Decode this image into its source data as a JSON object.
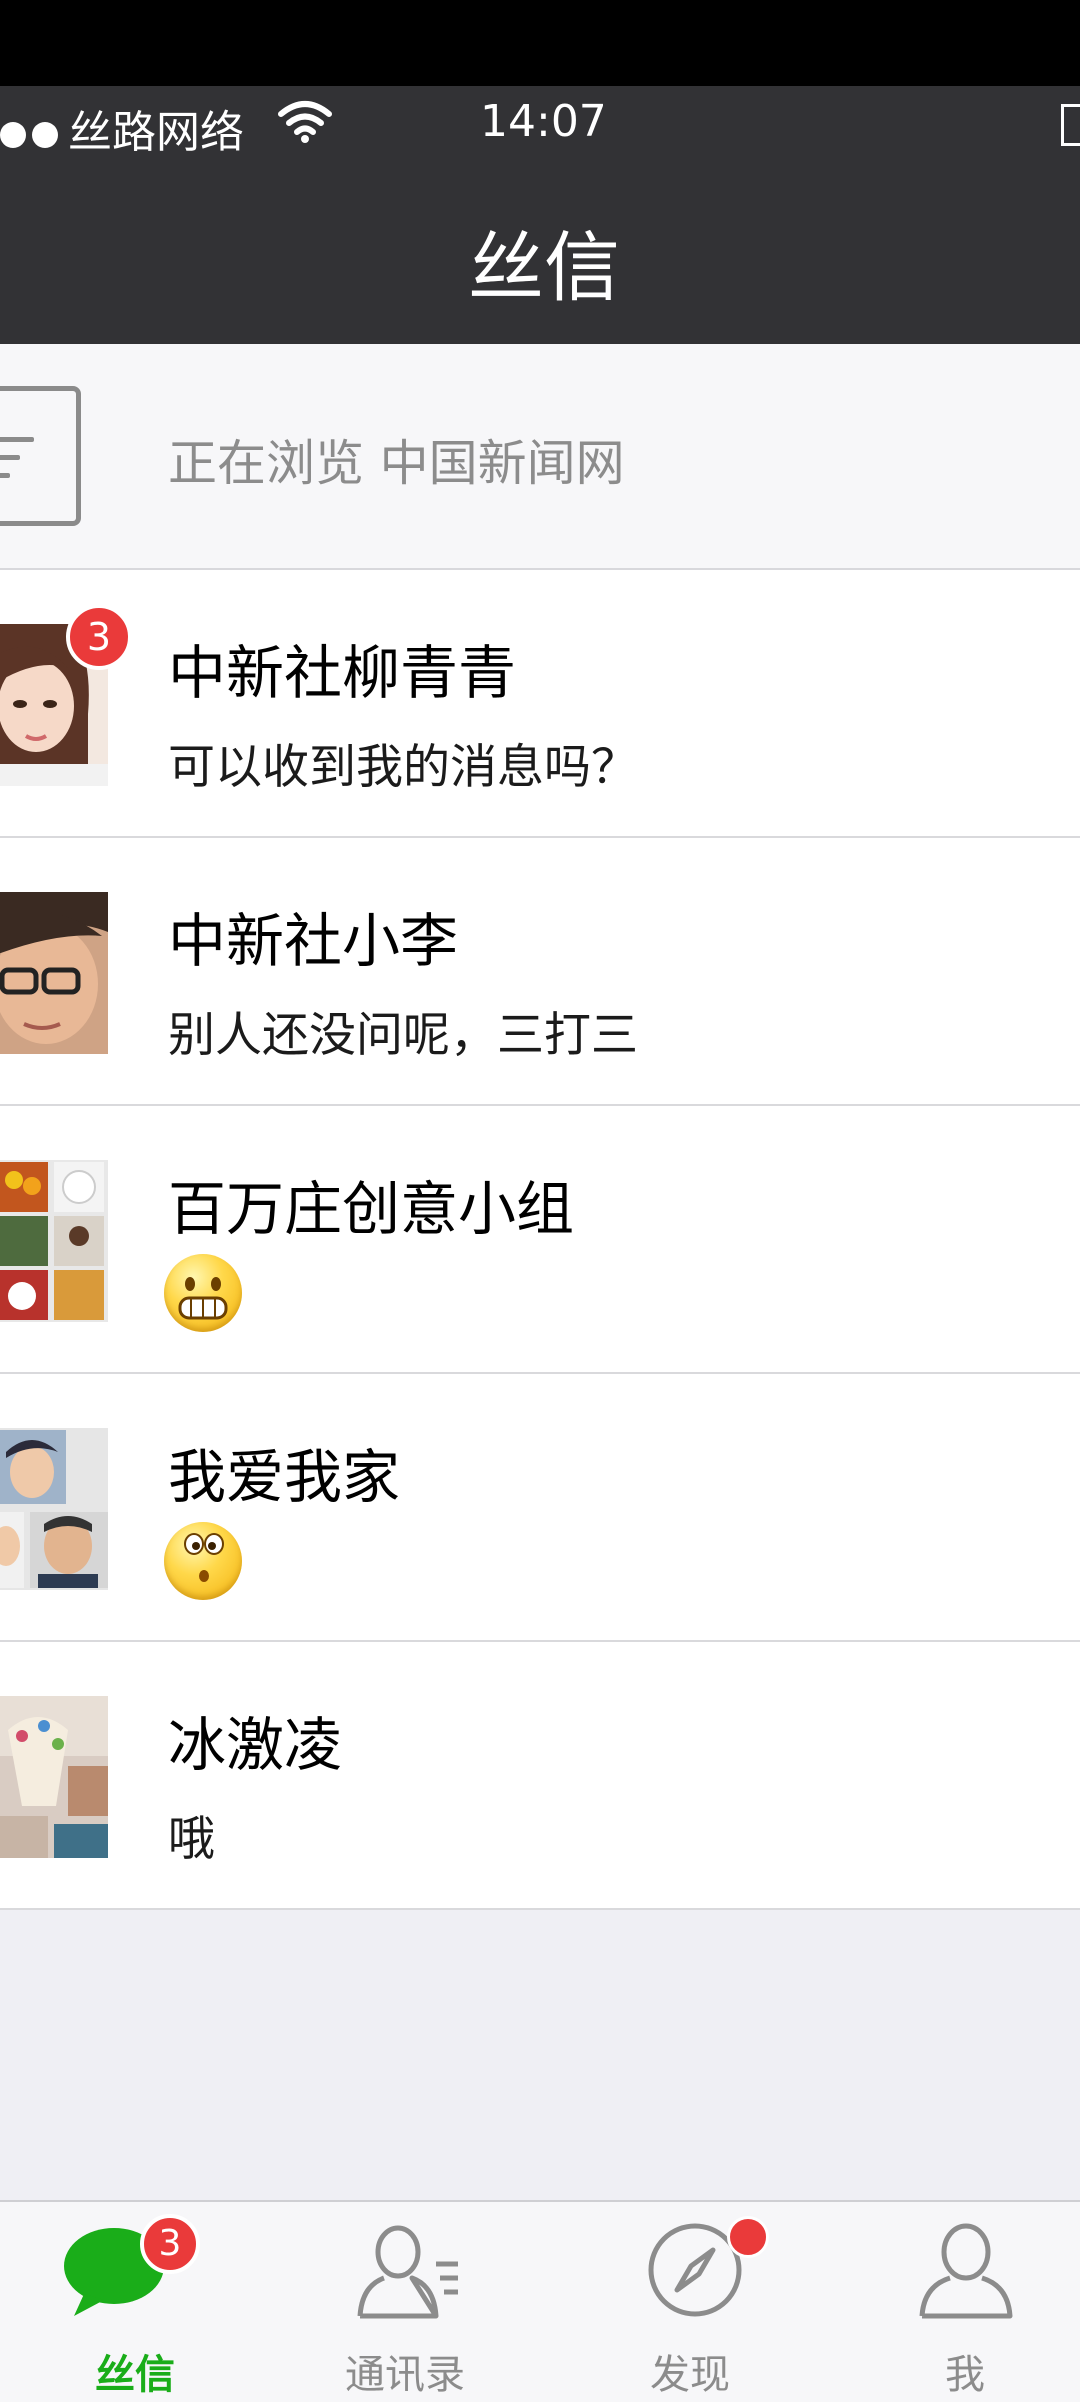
{
  "status_bar": {
    "carrier": "丝路网络",
    "time": "14:07"
  },
  "nav": {
    "title": "丝信"
  },
  "browsing_bar": {
    "text": "正在浏览  中国新闻网"
  },
  "chats": [
    {
      "name": "中新社柳青青",
      "message": "可以收到我的消息吗？",
      "badge": "3",
      "avatar": "avatar-woman"
    },
    {
      "name": "中新社小李",
      "message": "别人还没问呢，三打三",
      "avatar": "avatar-man-glasses"
    },
    {
      "name": "百万庄创意小组",
      "message": "",
      "emoji": "grin-emoji",
      "avatar": "group-avatar"
    },
    {
      "name": "我爱我家",
      "message": "",
      "emoji": "surprised-emoji",
      "avatar": "group-avatar"
    },
    {
      "name": "冰激凌",
      "message": "哦",
      "avatar": "avatar-ice-cream"
    }
  ],
  "tabs": [
    {
      "label": "丝信",
      "icon": "chat-bubble-icon",
      "badge": "3",
      "active": true
    },
    {
      "label": "通讯录",
      "icon": "contacts-icon"
    },
    {
      "label": "发现",
      "icon": "compass-icon",
      "dot": true
    },
    {
      "label": "我",
      "icon": "person-icon"
    }
  ],
  "colors": {
    "nav_bg": "#323235",
    "badge": "#ea3a3a",
    "active_tab": "#1aad19"
  }
}
